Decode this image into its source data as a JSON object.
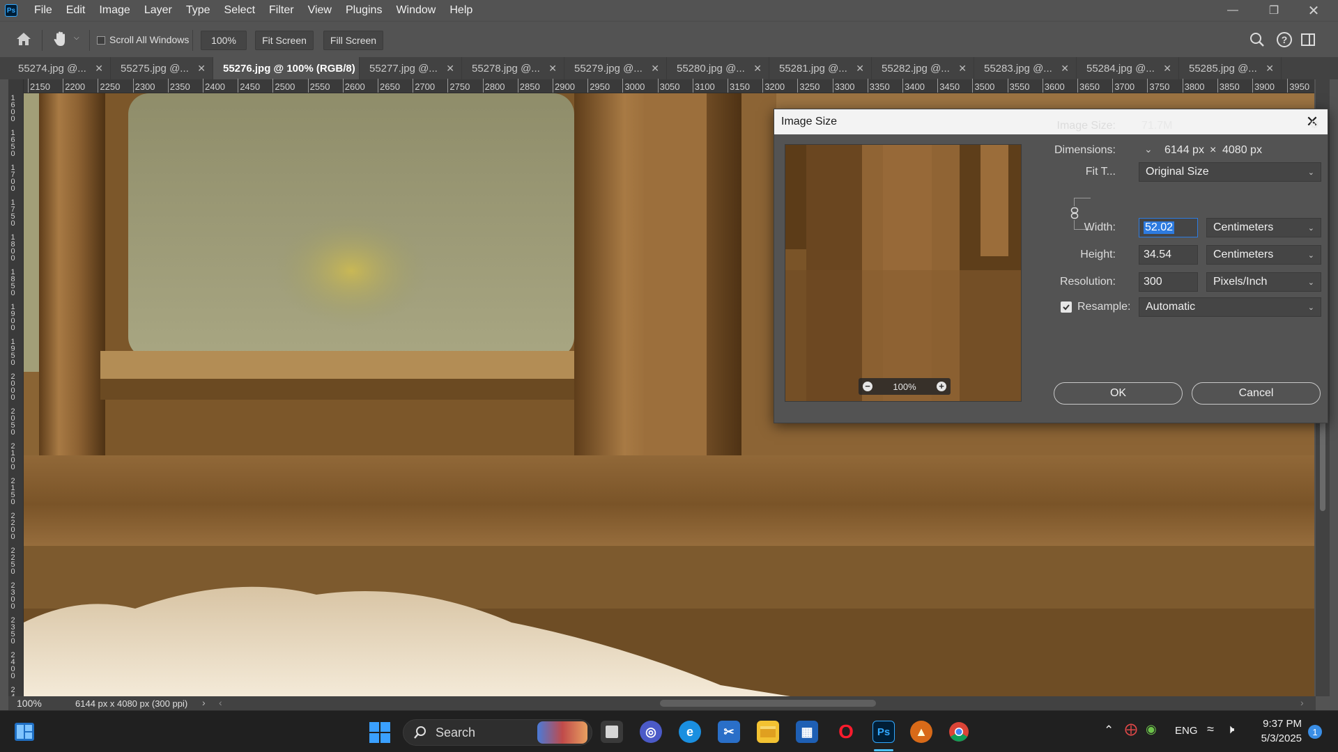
{
  "menubar": {
    "logo": "Ps",
    "items": [
      "File",
      "Edit",
      "Image",
      "Layer",
      "Type",
      "Select",
      "Filter",
      "View",
      "Plugins",
      "Window",
      "Help"
    ]
  },
  "options": {
    "scroll_all_windows": "Scroll All Windows",
    "zoom_value": "100%",
    "fit_screen": "Fit Screen",
    "fill_screen": "Fill Screen"
  },
  "tabs": [
    {
      "label": "55274.jpg @..."
    },
    {
      "label": "55275.jpg @..."
    },
    {
      "label": "55276.jpg @ 100% (RGB/8)",
      "active": true
    },
    {
      "label": "55277.jpg @..."
    },
    {
      "label": "55278.jpg @..."
    },
    {
      "label": "55279.jpg @..."
    },
    {
      "label": "55280.jpg @..."
    },
    {
      "label": "55281.jpg @..."
    },
    {
      "label": "55282.jpg @..."
    },
    {
      "label": "55283.jpg @..."
    },
    {
      "label": "55284.jpg @..."
    },
    {
      "label": "55285.jpg @..."
    }
  ],
  "ruler_top": [
    "2150",
    "2200",
    "2250",
    "2300",
    "2350",
    "2400",
    "2450",
    "2500",
    "2550",
    "2600",
    "2650",
    "2700",
    "2750",
    "2800",
    "2850",
    "2900",
    "2950",
    "3000",
    "3050",
    "3100",
    "3150",
    "3200",
    "3250",
    "3300",
    "3350",
    "3400",
    "3450",
    "3500",
    "3550",
    "3600",
    "3650",
    "3700",
    "3750",
    "3800",
    "3850",
    "3900",
    "3950"
  ],
  "ruler_left": [
    "1600",
    "1650",
    "1700",
    "1750",
    "1800",
    "1850",
    "1900",
    "1950",
    "2000",
    "2050",
    "2100",
    "2150",
    "2200",
    "2250",
    "2300",
    "2350",
    "2400",
    "2450",
    "2"
  ],
  "status": {
    "zoom": "100%",
    "doc_info": "6144 px x 4080 px (300 ppi)"
  },
  "dialog": {
    "title": "Image Size",
    "preview_zoom": "100%",
    "image_size_label": "Image Size:",
    "image_size_value": "71.7M",
    "dimensions_label": "Dimensions:",
    "dim_width": "6144 px",
    "dim_x": "×",
    "dim_height": "4080 px",
    "fit_label": "Fit T...",
    "fit_value": "Original Size",
    "width_label": "Width:",
    "width_value": "52.02",
    "width_unit": "Centimeters",
    "height_label": "Height:",
    "height_value": "34.54",
    "height_unit": "Centimeters",
    "resolution_label": "Resolution:",
    "resolution_value": "300",
    "resolution_unit": "Pixels/Inch",
    "resample_label": "Resample:",
    "resample_value": "Automatic",
    "ok": "OK",
    "cancel": "Cancel"
  },
  "taskbar": {
    "search": "Search",
    "language": "ENG",
    "time": "9:37 PM",
    "date": "5/3/2025",
    "notification_count": "1"
  }
}
